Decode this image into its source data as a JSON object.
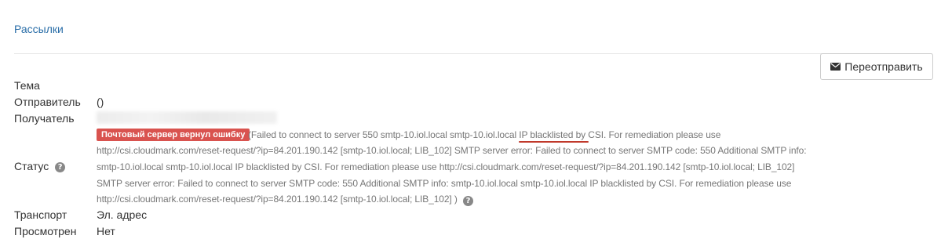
{
  "breadcrumb": {
    "label": "Рассылки"
  },
  "actions": {
    "resend_label": "Переотправить",
    "resend_icon": "envelope-icon"
  },
  "fields": {
    "subject_label": "Тема",
    "subject_value": "",
    "sender_label": "Отправитель",
    "sender_value": "()",
    "recipient_label": "Получатель",
    "status_label": "Статус",
    "transport_label": "Транспорт",
    "transport_value": "Эл. адрес",
    "viewed_label": "Просмотрен",
    "viewed_value": "Нет"
  },
  "status": {
    "badge": "Почтовый сервер вернул ошибку",
    "badge_color": "#d9534f",
    "error_lines": [
      "(Failed to connect to server 550 smtp-10.iol.local smtp-10.iol.local IP blacklisted by CSI. For remediation please use",
      "http://csi.cloudmark.com/reset-request/?ip=84.201.190.142 [smtp-10.iol.local; LIB_102] SMTP server error: Failed to connect to server SMTP code: 550 Additional SMTP info:",
      "smtp-10.iol.local smtp-10.iol.local IP blacklisted by CSI. For remediation please use http://csi.cloudmark.com/reset-request/?ip=84.201.190.142 [smtp-10.iol.local; LIB_102]",
      "SMTP server error: Failed to connect to server SMTP code: 550 Additional SMTP info: smtp-10.iol.local smtp-10.iol.local IP blacklisted by CSI. For remediation please use",
      "http://csi.cloudmark.com/reset-request/?ip=84.201.190.142 [smtp-10.iol.local; LIB_102] )"
    ],
    "help_icon": "?"
  },
  "colors": {
    "link": "#2a6ea8",
    "text": "#333333",
    "muted": "#777777",
    "annotation": "#c0392b"
  }
}
